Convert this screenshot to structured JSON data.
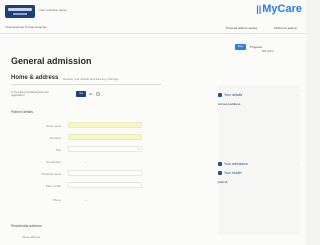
{
  "header": {
    "org_name": "Your practice name",
    "brand_icon": "||",
    "brand_name": "MyCare",
    "breadcrumb": "Onlinewebapp Private Hospital",
    "link_save_later": "Proceed without saving",
    "link_access_key": "Online for saving"
  },
  "toolbar": {
    "save_label": "Save",
    "progress_label": "Progress",
    "progress_value": "0% done",
    "progress_mark": "6%"
  },
  "form": {
    "title": "General admission",
    "section_title": "Home & address",
    "section_hint": "Review your details and add any changes",
    "question": "Is the patient completing their own registration?",
    "yes_label": "Yes",
    "no_label": "No",
    "help_icon": "?",
    "patient_group": "Patient details",
    "fields": [
      {
        "label": "Given name"
      },
      {
        "label": "Surname"
      },
      {
        "label": "Title"
      },
      {
        "label": "Gender/Sex"
      },
      {
        "label": "Preferred name"
      },
      {
        "label": "Date of birth"
      },
      {
        "label": "Phone"
      }
    ],
    "gender_option": "—",
    "residential_group": "Residential address",
    "last_field_label": "Street address"
  },
  "panel": {
    "item_details": "Your details",
    "item_details_sub": "Account address",
    "item_admission": "Your admission",
    "item_health": "Your health",
    "item_submit": "Submit"
  }
}
